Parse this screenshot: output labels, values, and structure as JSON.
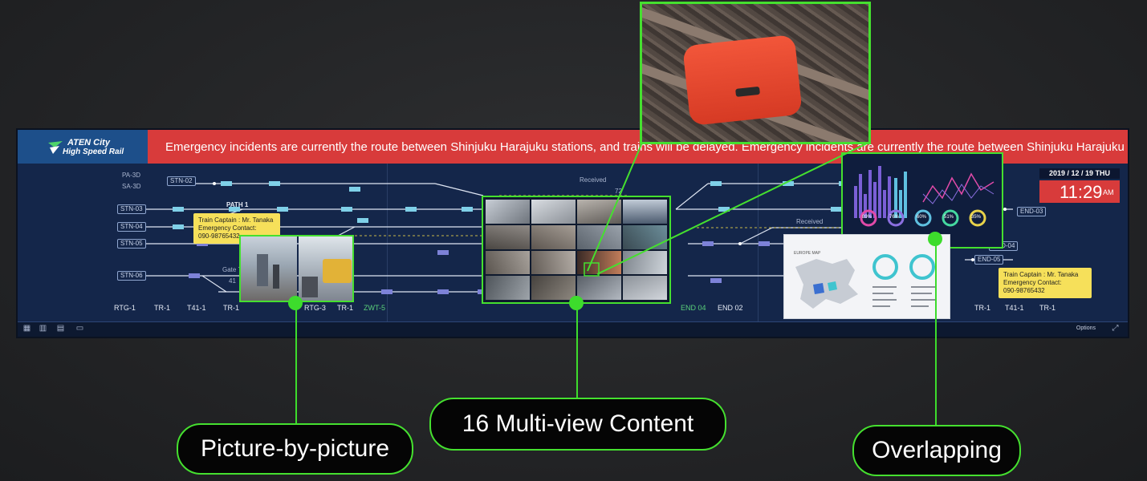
{
  "header": {
    "logo_line1": "ATEN City",
    "logo_line2": "High Speed Rail",
    "ticker": "Emergency incidents are currently the route between Shinjuku Harajuku stations, and trains will be delayed.  Emergency incidents are currently the route between Shinjuku Harajuku stations, and trains will be delayed."
  },
  "clock": {
    "date": "2019 / 12 / 19  THU",
    "time": "11:29",
    "ampm": "AM"
  },
  "stations": [
    "STN-02",
    "STN-03",
    "STN-04",
    "STN-05",
    "STN-06"
  ],
  "platforms": [
    "PA-3D",
    "SA-3D"
  ],
  "track_labels_left": [
    "RTG-1",
    "TR-1",
    "T41-1",
    "TR-1"
  ],
  "track_labels_mid": [
    "RTG-3",
    "TR-1"
  ],
  "track_label_green": "ZWT-5",
  "track_labels_right": [
    "END 04",
    "END 02"
  ],
  "track_labels_far": [
    "TR-1",
    "T41-1",
    "TR-1"
  ],
  "end_tags": [
    "END-03",
    "END-04",
    "END-05"
  ],
  "misc_labels": {
    "path1": "PATH 1",
    "gate": "Gate 7",
    "received": "Received",
    "num41": "41",
    "num72": "72"
  },
  "tooltip_left": {
    "line1": "Train Captain : Mr. Tanaka",
    "line2": "Emergency Contact:",
    "line3": "090-98765432"
  },
  "tooltip_right": {
    "line1": "Train Captain : Mr. Tanaka",
    "line2": "Emergency Contact:",
    "line3": "090-98765432"
  },
  "dashboard": {
    "gauges": [
      "89%",
      "76%",
      "60%",
      "51%",
      "35%"
    ]
  },
  "map_panel": {
    "title": "EUROPE MAP"
  },
  "bottombar": {
    "options": "Options"
  },
  "callouts": {
    "pbp": "Picture-by-picture",
    "multiview": "16 Multi-view Content",
    "overlap": "Overlapping"
  },
  "colors": {
    "accent_green": "#45e02f",
    "alert_red": "#d83b3b",
    "wall_navy": "#14264a"
  }
}
